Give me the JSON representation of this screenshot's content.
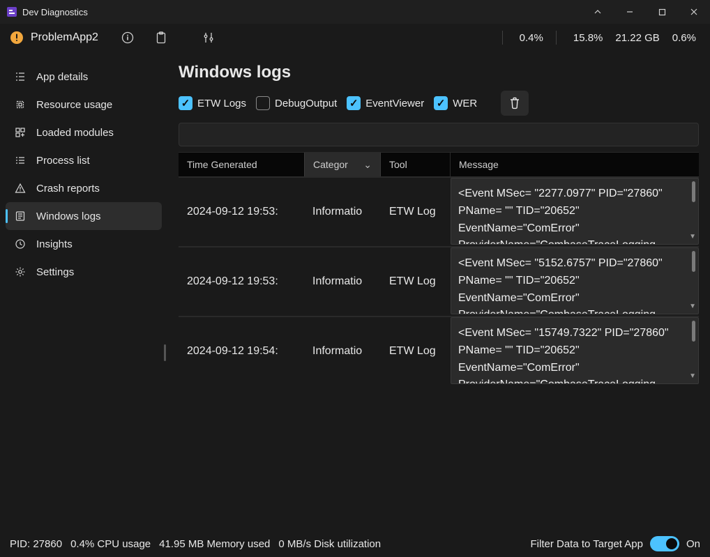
{
  "window": {
    "title": "Dev Diagnostics"
  },
  "header": {
    "app_name": "ProblemApp2",
    "metrics": {
      "cpu": "0.4%",
      "mem": "15.8%",
      "total": "21.22 GB",
      "disk": "0.6%"
    }
  },
  "sidebar": {
    "items": [
      {
        "label": "App details"
      },
      {
        "label": "Resource usage"
      },
      {
        "label": "Loaded modules"
      },
      {
        "label": "Process list"
      },
      {
        "label": "Crash reports"
      },
      {
        "label": "Windows logs"
      },
      {
        "label": "Insights"
      },
      {
        "label": "Settings"
      }
    ]
  },
  "page": {
    "title": "Windows logs"
  },
  "filters": {
    "etw": {
      "label": "ETW Logs",
      "checked": true
    },
    "debug": {
      "label": "DebugOutput",
      "checked": false
    },
    "eventviewer": {
      "label": "EventViewer",
      "checked": true
    },
    "wer": {
      "label": "WER",
      "checked": true
    }
  },
  "table": {
    "headers": {
      "time": "Time Generated",
      "category": "Categor",
      "tool": "Tool",
      "message": "Message"
    },
    "rows": [
      {
        "time": "2024-09-12 19:53:",
        "category": "Informatio",
        "tool": "ETW Log",
        "message": "<Event MSec=  \"2277.0977\" PID=\"27860\" PName=        \"\" TID=\"20652\" EventName=\"ComError\" ProviderName=\"CombaseTraceLogging"
      },
      {
        "time": "2024-09-12 19:53:",
        "category": "Informatio",
        "tool": "ETW Log",
        "message": "<Event MSec=  \"5152.6757\" PID=\"27860\" PName=        \"\" TID=\"20652\" EventName=\"ComError\" ProviderName=\"CombaseTraceLogging"
      },
      {
        "time": "2024-09-12 19:54:",
        "category": "Informatio",
        "tool": "ETW Log",
        "message": "<Event MSec=  \"15749.7322\" PID=\"27860\" PName=        \"\" TID=\"20652\" EventName=\"ComError\" ProviderName=\"CombaseTraceLogging"
      }
    ]
  },
  "status": {
    "pid": "PID: 27860",
    "cpu": "0.4% CPU usage",
    "mem": "41.95 MB Memory used",
    "disk": "0 MB/s Disk utilization",
    "filter_label": "Filter Data to Target App",
    "toggle_state": "On"
  }
}
